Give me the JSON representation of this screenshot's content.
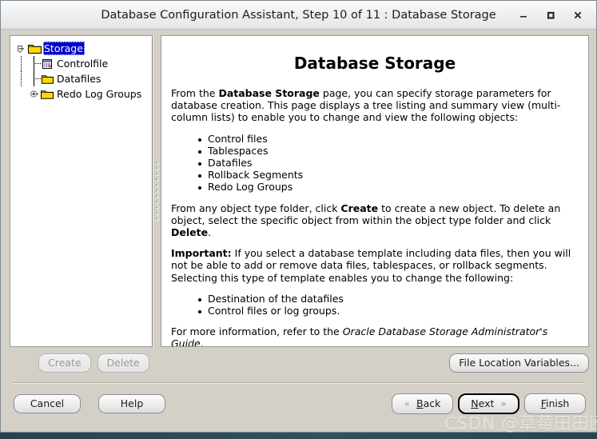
{
  "window": {
    "title": "Database Configuration Assistant, Step 10 of 11 : Database Storage",
    "minimize_label": "minimize-icon",
    "maximize_label": "maximize-icon",
    "close_label": "close-icon"
  },
  "tree": {
    "root": {
      "label": "Storage",
      "selected": true,
      "expanded": true
    },
    "children": [
      {
        "label": "Controlfile",
        "icon": "controlfile-icon",
        "expandable": false
      },
      {
        "label": "Datafiles",
        "icon": "folder-icon",
        "expandable": false
      },
      {
        "label": "Redo Log Groups",
        "icon": "folder-icon",
        "expandable": true
      }
    ]
  },
  "content": {
    "title": "Database Storage",
    "para1_a": "From the ",
    "para1_b": "Database Storage",
    "para1_c": " page, you can specify storage parameters for database creation. This page displays a tree listing and summary view (multi-column lists) to enable you to change and view the following objects:",
    "list1": [
      "Control files",
      "Tablespaces",
      "Datafiles",
      "Rollback Segments",
      "Redo Log Groups"
    ],
    "para2_a": "From any object type folder, click ",
    "para2_b": "Create",
    "para2_c": " to create a new object. To delete an object, select the specific object from within the object type folder and click ",
    "para2_d": "Delete",
    "para2_e": ".",
    "para3_a": "Important:",
    "para3_b": " If you select a database template including data files, then you will not be able to add or remove data files, tablespaces, or rollback segments. Selecting this type of template enables you to change the following:",
    "list2": [
      "Destination of the datafiles",
      "Control files or log groups."
    ],
    "para4_a": "For more information, refer to the ",
    "para4_b": "Oracle Database Storage Administrator's Guide",
    "para4_c": "."
  },
  "buttons": {
    "create": "Create",
    "delete": "Delete",
    "file_location_variables": "File Location Variables...",
    "cancel": "Cancel",
    "help": "Help",
    "back": "Back",
    "back_mnemonic": "B",
    "back_rest": "ack",
    "next": "Next",
    "next_mnemonic": "N",
    "next_rest": "ext",
    "finish": "Finish",
    "finish_mnemonic": "F",
    "finish_rest": "inish",
    "back_chevron": "«",
    "next_chevron": "»"
  },
  "watermark": {
    "text": "CSDN @草莓田田圈"
  },
  "colors": {
    "dialog_bg": "#d4d0c8",
    "panel_bg": "#ffffff",
    "selection_blue": "#0000c8",
    "folder_yellow": "#ffd700",
    "desktop": "#2e4250"
  }
}
